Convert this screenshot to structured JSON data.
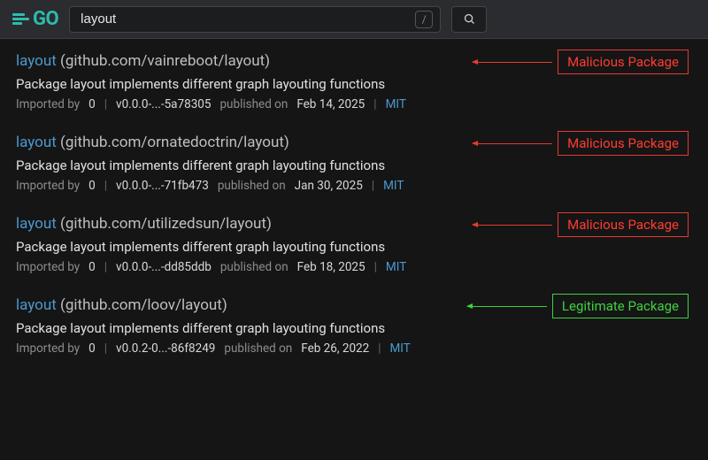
{
  "header": {
    "logo_text": "GO",
    "search_value": "layout",
    "slash_hint": "/"
  },
  "annotations": {
    "malicious": "Malicious Package",
    "legitimate": "Legitimate Package"
  },
  "meta_labels": {
    "imported_by": "Imported by",
    "published_on": "published on"
  },
  "results": [
    {
      "name": "layout",
      "path": "(github.com/vainreboot/layout)",
      "desc": "Package layout implements different graph layouting functions",
      "imported_by": "0",
      "version": "v0.0.0-...-5a78305",
      "date": "Feb 14, 2025",
      "license": "MIT",
      "flag": "malicious"
    },
    {
      "name": "layout",
      "path": "(github.com/ornatedoctrin/layout)",
      "desc": "Package layout implements different graph layouting functions",
      "imported_by": "0",
      "version": "v0.0.0-...-71fb473",
      "date": "Jan 30, 2025",
      "license": "MIT",
      "flag": "malicious"
    },
    {
      "name": "layout",
      "path": "(github.com/utilizedsun/layout)",
      "desc": "Package layout implements different graph layouting functions",
      "imported_by": "0",
      "version": "v0.0.0-...-dd85ddb",
      "date": "Feb 18, 2025",
      "license": "MIT",
      "flag": "malicious"
    },
    {
      "name": "layout",
      "path": "(github.com/loov/layout)",
      "desc": "Package layout implements different graph layouting functions",
      "imported_by": "0",
      "version": "v0.0.2-0...-86f8249",
      "date": "Feb 26, 2022",
      "license": "MIT",
      "flag": "legitimate"
    }
  ]
}
